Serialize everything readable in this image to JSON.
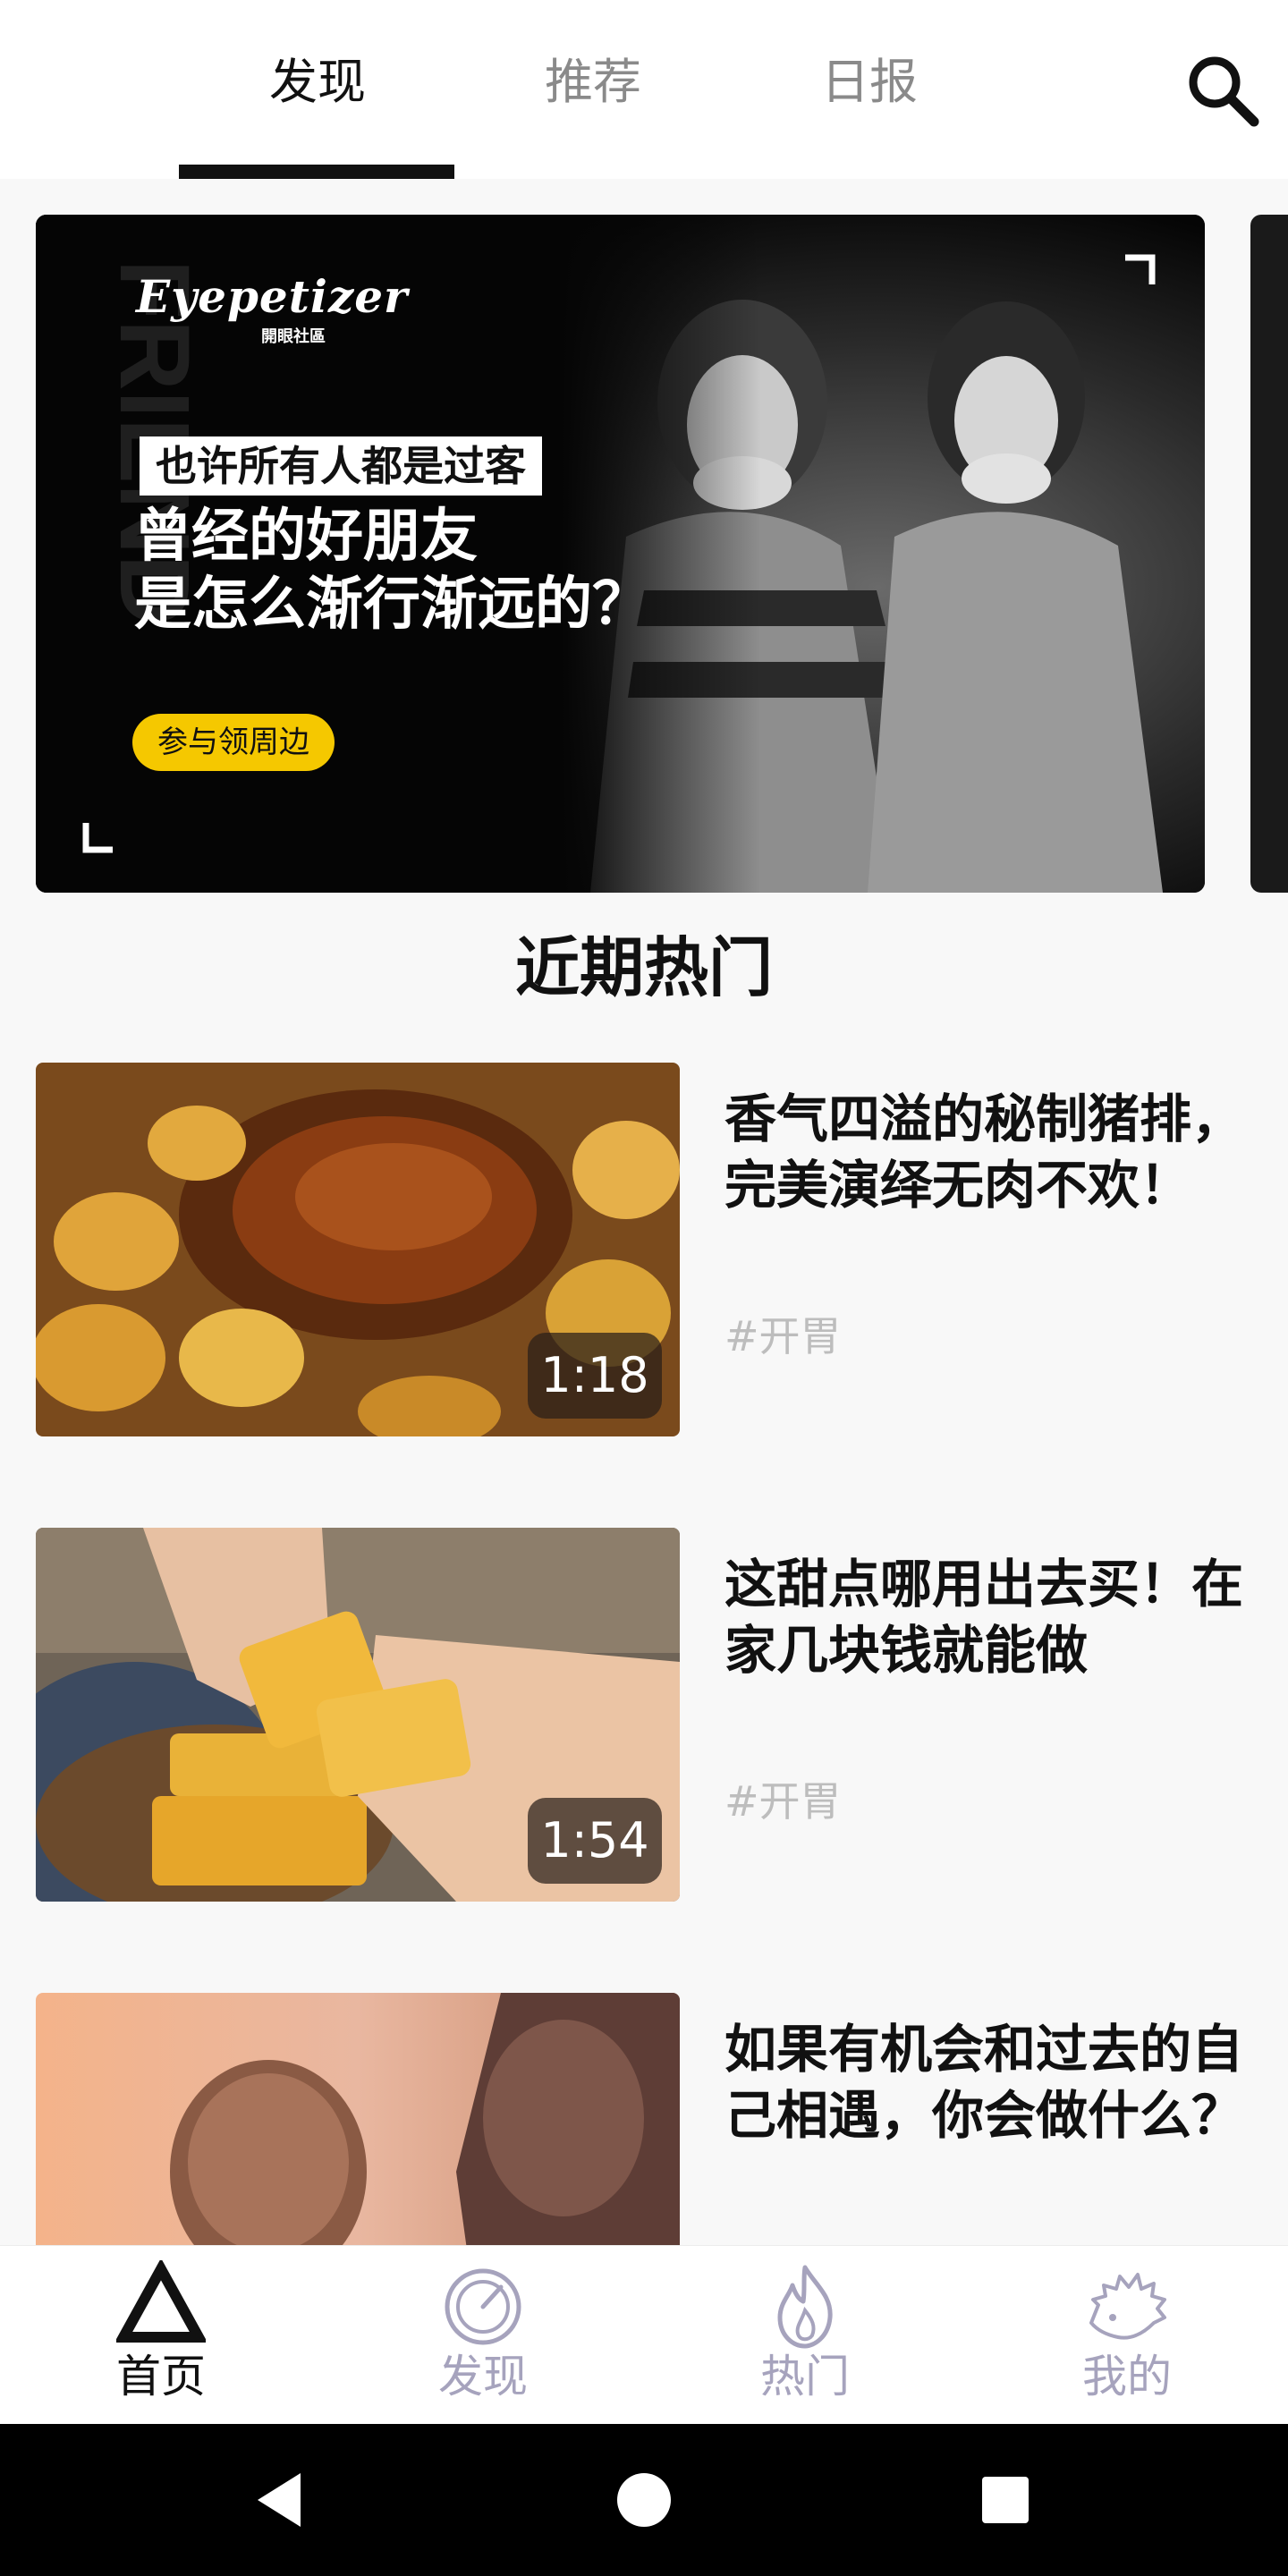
{
  "top_tabs": [
    {
      "label": "发现",
      "active": true
    },
    {
      "label": "推荐",
      "active": false
    },
    {
      "label": "日报",
      "active": false
    }
  ],
  "search": {
    "icon": "search-icon"
  },
  "banner": {
    "brand": "Eyepetizer",
    "brand_sub": "開眼社區",
    "kicker": "也许所有人都是过客",
    "headline_line1": "曾经的好朋友",
    "headline_line2": "是怎么渐行渐远的？",
    "cta": "参与领周边",
    "watermark": "FRIEND"
  },
  "section_title": "近期热门",
  "videos": [
    {
      "title": "香气四溢的秘制猪排，完美演绎无肉不欢！",
      "tag": "#开胃",
      "duration": "1:18"
    },
    {
      "title": "这甜点哪用出去买！在家几块钱就能做",
      "tag": "#开胃",
      "duration": "1:54"
    },
    {
      "title": "如果有机会和过去的自己相遇，你会做什么？",
      "tag": "",
      "duration": ""
    }
  ],
  "bottom_nav": [
    {
      "label": "首页",
      "icon": "triangle-home-icon",
      "active": true
    },
    {
      "label": "发现",
      "icon": "compass-icon",
      "active": false
    },
    {
      "label": "热门",
      "icon": "flame-icon",
      "active": false
    },
    {
      "label": "我的",
      "icon": "hedgehog-icon",
      "active": false
    }
  ],
  "system_nav": {
    "back": "back-icon",
    "home": "home-icon",
    "recents": "recents-icon"
  },
  "colors": {
    "accent": "#111111",
    "inactive_tab": "#8a8a8a",
    "inactive_nav": "#a6a3bd",
    "cta_yellow": "#f5c800",
    "tag_gray": "#bdbdbd",
    "background": "#f8f8f8"
  }
}
